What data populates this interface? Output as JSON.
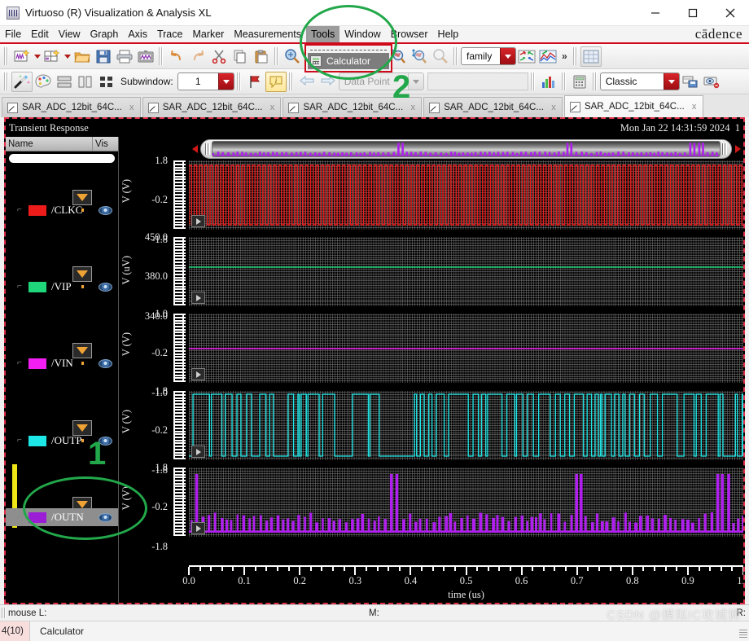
{
  "window": {
    "title": "Virtuoso (R) Visualization & Analysis XL",
    "app_icon": "waveform-window-icon",
    "minimize": "–",
    "maximize": "□",
    "close": "✕"
  },
  "menubar": {
    "items": [
      {
        "label": "File",
        "mnemonic": "F"
      },
      {
        "label": "Edit",
        "mnemonic": "E"
      },
      {
        "label": "View",
        "mnemonic": "V"
      },
      {
        "label": "Graph",
        "mnemonic": "G"
      },
      {
        "label": "Axis",
        "mnemonic": "A"
      },
      {
        "label": "Trace",
        "mnemonic": "T"
      },
      {
        "label": "Marker",
        "mnemonic": "M"
      },
      {
        "label": "Measurements",
        "mnemonic": "e"
      },
      {
        "label": "Tools",
        "mnemonic": "T",
        "active": true
      },
      {
        "label": "Window",
        "mnemonic": "W"
      },
      {
        "label": "Browser",
        "mnemonic": "B"
      },
      {
        "label": "Help",
        "mnemonic": "H"
      }
    ],
    "brand": "cādence"
  },
  "tools_menu": {
    "open": true,
    "items": [
      {
        "label": "Calculator",
        "icon": "calculator-icon",
        "highlighted": true
      }
    ]
  },
  "toolbar1": {
    "buttons": [
      {
        "name": "new-window",
        "icon": "new-waveform-window-icon"
      },
      {
        "name": "new-window-dropdown",
        "icon": "chevron-down-icon"
      },
      {
        "name": "new-subwindow",
        "icon": "new-subwindow-icon"
      },
      {
        "name": "new-subwindow-dropdown",
        "icon": "chevron-down-icon"
      },
      {
        "name": "open",
        "icon": "open-folder-icon"
      },
      {
        "name": "save",
        "icon": "floppy-save-icon"
      },
      {
        "name": "print",
        "icon": "printer-icon"
      },
      {
        "name": "screenshot",
        "icon": "waveform-capture-icon"
      },
      {
        "name": "undo",
        "icon": "undo-arrow-icon"
      },
      {
        "name": "redo",
        "icon": "redo-arrow-icon"
      },
      {
        "name": "cut",
        "icon": "scissors-icon"
      },
      {
        "name": "copy",
        "icon": "copy-pages-icon"
      },
      {
        "name": "paste",
        "icon": "clipboard-paste-icon"
      },
      {
        "name": "zoom-fit",
        "icon": "zoom-fit-icon"
      },
      {
        "name": "zoom-in",
        "icon": "zoom-in-icon"
      },
      {
        "name": "zoom-out",
        "icon": "zoom-out-icon"
      },
      {
        "name": "zoom-x",
        "icon": "zoom-horizontal-icon"
      },
      {
        "name": "zoom-area",
        "icon": "zoom-area-icon"
      },
      {
        "name": "zoom-y-in",
        "icon": "zoom-vertical-in-icon"
      },
      {
        "name": "zoom-y-out",
        "icon": "zoom-vertical-out-icon"
      },
      {
        "name": "zoom-disabled",
        "icon": "zoom-disabled-icon"
      }
    ],
    "family_combo": "family",
    "strip_buttons": [
      {
        "name": "split-traces",
        "icon": "split-traces-icon"
      },
      {
        "name": "merge-traces",
        "icon": "merge-traces-icon"
      }
    ],
    "overflow": "»",
    "grid_button": "grid-icon"
  },
  "toolbar2": {
    "buttons": [
      {
        "name": "wand",
        "icon": "magic-wand-icon"
      },
      {
        "name": "palette",
        "icon": "palette-icon"
      },
      {
        "name": "stack-subwindows",
        "icon": "stack-horizontal-icon"
      },
      {
        "name": "tile-subwindows",
        "icon": "tile-vertical-icon"
      },
      {
        "name": "strip-chart",
        "icon": "strip-chart-icon"
      }
    ],
    "subwindow_label": "Subwindow:",
    "subwindow_value": "1",
    "flag_button": "flag-marker-icon",
    "info_button": "info-annotation-icon",
    "nav_back": "nav-back-arrow-icon",
    "nav_forward": "nav-forward-arrow-icon",
    "datapoint_combo": "Data Point",
    "search_value": "",
    "histogram_button": "histogram-icon",
    "calculator_button": "calculator-icon",
    "theme_combo": "Classic",
    "save_view_button": "save-view-icon",
    "hide-view_button": "hide-view-icon"
  },
  "tabs": [
    {
      "label": "SAR_ADC_12bit_64C...",
      "selected": false,
      "close": "x"
    },
    {
      "label": "SAR_ADC_12bit_64C...",
      "selected": false,
      "close": "x"
    },
    {
      "label": "SAR_ADC_12bit_64C...",
      "selected": false,
      "close": "x"
    },
    {
      "label": "SAR_ADC_12bit_64C...",
      "selected": false,
      "close": "x"
    },
    {
      "label": "SAR_ADC_12bit_64C...",
      "selected": true,
      "close": "x"
    }
  ],
  "plot": {
    "title": "Transient Response",
    "timestamp": "Mon Jan 22 14:31:59 2024",
    "subwindow_number": "1"
  },
  "signal_list": {
    "column_name": "Name",
    "column_vis": "Vis",
    "search_value": "",
    "filter_icon": "filter-funnel-icon",
    "eye_icon": "visibility-eye-icon",
    "signals": [
      {
        "name": "/CLKC",
        "color": "#ee1b1b",
        "selected": false
      },
      {
        "name": "/VIP",
        "color": "#1fd67a",
        "selected": false
      },
      {
        "name": "/VIN",
        "color": "#f21ef2",
        "selected": false
      },
      {
        "name": "/OUTP",
        "color": "#1ee7e7",
        "selected": false
      },
      {
        "name": "/OUTN",
        "color": "#9b1ed6",
        "selected": true
      }
    ]
  },
  "chart_data": {
    "type": "line",
    "title": "Transient Response",
    "xlabel": "time (us)",
    "xlim": [
      0.0,
      1.0
    ],
    "xticks": [
      "0.0",
      "0.1",
      "0.2",
      "0.3",
      "0.4",
      "0.5",
      "0.6",
      "0.7",
      "0.8",
      "0.9",
      "1.0"
    ],
    "grid": true,
    "legend": "left-signal-panel",
    "panels": [
      {
        "signal": "/CLKC",
        "color": "#ee1b1b",
        "ylabel": "V (V)",
        "yticks": [
          "1.8",
          "-0.2",
          "-1.8"
        ],
        "ylim": [
          -1.8,
          1.8
        ],
        "waveform": "square-clock",
        "description": "Dense periodic clock pulse train, ~100 cycles across 1 us, rail-to-rail 0 to 1.8 V"
      },
      {
        "signal": "/VIP",
        "color": "#1fd67a",
        "ylabel": "V (uV)",
        "yticks": [
          "450.0",
          "380.0",
          "340.0"
        ],
        "ylim": [
          340.0,
          450.0
        ],
        "waveform": "flat",
        "value": 400.0,
        "description": "Flat DC line near 400 uV"
      },
      {
        "signal": "/VIN",
        "color": "#f21ef2",
        "ylabel": "V (V)",
        "yticks": [
          "1.0",
          "-0.2",
          "-1.0"
        ],
        "ylim": [
          -1.0,
          1.0
        ],
        "waveform": "flat",
        "value": -0.2,
        "description": "Flat DC line near -0.2 V"
      },
      {
        "signal": "/OUTP",
        "color": "#1ee7e7",
        "ylabel": "V (V)",
        "yticks": [
          "1.8",
          "-0.2",
          "-1.8"
        ],
        "ylim": [
          -1.8,
          1.8
        ],
        "waveform": "digital-bitstream",
        "description": "Dense digital bitstream switching between 0 and 1.8 V with varying pulse widths"
      },
      {
        "signal": "/OUTN",
        "color": "#9b1ed6",
        "ylabel": "V (V)",
        "yticks": [
          "1.8",
          "-0.2",
          "-1.8"
        ],
        "ylim": [
          -1.8,
          1.8
        ],
        "waveform": "narrow-pulses",
        "description": "Narrow low-amplitude pulses with three full-height spikes near t = 0.37, 0.70 and 0.96 us"
      }
    ]
  },
  "statusbar": {
    "mouse_label": "mouse L:",
    "middle_label": "M:",
    "right_label": "R:"
  },
  "statusbar2": {
    "count": "4(10)",
    "message": "Calculator"
  },
  "watermark": "CSDN @模拟IC攻城狮",
  "annotations": [
    {
      "name": "circle-tools-menu",
      "shape": "circle",
      "color": "#22a84a"
    },
    {
      "name": "marker-2",
      "label": "2",
      "color": "#22a84a"
    },
    {
      "name": "marker-1",
      "label": "1",
      "color": "#22a84a"
    },
    {
      "name": "ellipse-outn-row",
      "shape": "ellipse",
      "color": "#22a84a"
    }
  ]
}
